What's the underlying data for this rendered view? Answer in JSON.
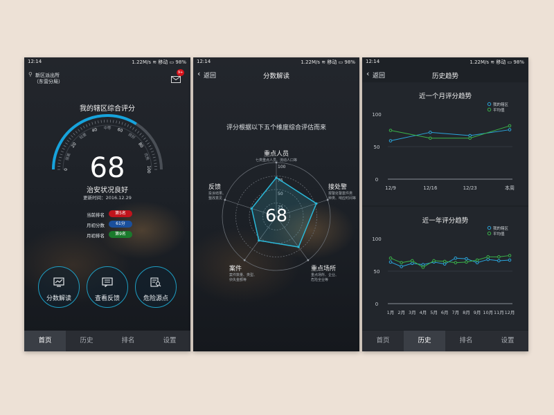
{
  "status": {
    "time": "12:14",
    "info": "1.22M/s ≋ 移动 ▭ 98%"
  },
  "screen1": {
    "location_line1": "新区派出所",
    "location_line2": "（东营分局）",
    "mail_badge": "9+",
    "title": "我的辖区综合评分",
    "gauge_numbers": [
      "0",
      "20",
      "40",
      "60",
      "80",
      "100"
    ],
    "gauge_words": [
      "很差",
      "较差",
      "中等",
      "良好",
      "优秀"
    ],
    "score": "68",
    "score_value": 68,
    "status_text": "治安状况良好",
    "update_time": "更新时间：2016.12.29",
    "rows": [
      {
        "label": "当前排名",
        "badge": "第5名",
        "color": "#c0141c"
      },
      {
        "label": "月初分数",
        "badge": "61分",
        "color": "#1a4f9c"
      },
      {
        "label": "月初排名",
        "badge": "第9名",
        "color": "#1a7a2c"
      }
    ],
    "buttons": [
      "分数解读",
      "查看反馈",
      "危险源点"
    ]
  },
  "screen2": {
    "back": "返回",
    "title": "分数解读",
    "subtitle": "评分根据以下五个维度综合评估而来",
    "score": "68",
    "ring_labels": [
      "100",
      "75",
      "50",
      "25"
    ],
    "dims": [
      {
        "name": "重点人员",
        "desc": "七类重点人员、流动人口等"
      },
      {
        "name": "接处警",
        "desc1": "报警处警案件类",
        "desc2": "种类、响应时间等"
      },
      {
        "name": "重点场所",
        "desc1": "重点场所、企业、",
        "desc2": "危险全业等"
      },
      {
        "name": "案件",
        "desc1": "案件数量、类型、",
        "desc2": "侦失金额等"
      },
      {
        "name": "反馈",
        "desc1": "投诉结果、",
        "desc2": "整改意见"
      }
    ],
    "radar_values": [
      72,
      78,
      70,
      55,
      48
    ]
  },
  "screen3": {
    "back": "返回",
    "title": "历史趋势",
    "legend": [
      "我的辖区",
      "平均值"
    ],
    "colors": {
      "mine": "#2aa6dd",
      "avg": "#3ab54a"
    },
    "month_title": "近一个月评分趋势",
    "year_title": "近一年评分趋势"
  },
  "chart_data": [
    {
      "type": "line",
      "title": "近一个月评分趋势",
      "categories": [
        "12/9",
        "12/16",
        "12/23",
        "本周"
      ],
      "ylim": [
        0,
        100
      ],
      "yticks": [
        "100",
        "50",
        "0"
      ],
      "series": [
        {
          "name": "我的辖区",
          "values": [
            59,
            72,
            67,
            76
          ]
        },
        {
          "name": "平均值",
          "values": [
            75,
            63,
            63,
            82
          ]
        }
      ]
    },
    {
      "type": "line",
      "title": "近一年评分趋势",
      "categories": [
        "1月",
        "2月",
        "3月",
        "4月",
        "5月",
        "6月",
        "7月",
        "8月",
        "9月",
        "10月",
        "11月",
        "12月"
      ],
      "ylim": [
        0,
        100
      ],
      "yticks": [
        "100",
        "50",
        "0"
      ],
      "series": [
        {
          "name": "我的辖区",
          "values": [
            64,
            57,
            62,
            60,
            64,
            61,
            70,
            69,
            63,
            68,
            66,
            67
          ]
        },
        {
          "name": "平均值",
          "values": [
            70,
            63,
            66,
            56,
            66,
            65,
            63,
            64,
            67,
            72,
            72,
            74
          ]
        }
      ]
    }
  ],
  "tabs": [
    "首页",
    "历史",
    "排名",
    "设置"
  ]
}
